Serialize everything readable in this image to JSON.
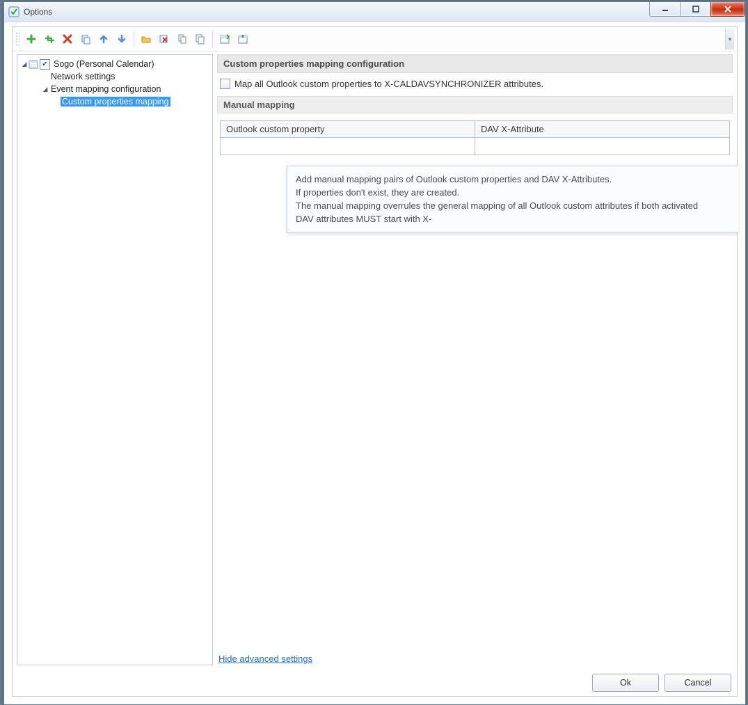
{
  "window": {
    "title": "Options"
  },
  "tree": {
    "root_label": "Sogo (Personal Calendar)",
    "root_checked": true,
    "network_settings": "Network settings",
    "event_mapping": "Event mapping configuration",
    "custom_mapping": "Custom properties mapping"
  },
  "content": {
    "section_title": "Custom properties mapping configuration",
    "map_all_label": "Map all Outlook custom properties to X-CALDAVSYNCHRONIZER attributes.",
    "map_all_checked": false,
    "manual_mapping_title": "Manual mapping",
    "table": {
      "col_outlook": "Outlook custom property",
      "col_dav": "DAV X-Attribute"
    },
    "tooltip": {
      "l1": "Add manual mapping pairs of Outlook custom properties and DAV X-Attributes.",
      "l2": "If properties don't exist, they are created.",
      "l3": "The manual mapping overrules the general mapping of all Outlook custom attributes if both activated",
      "l4": "DAV attributes MUST start with X-"
    },
    "hide_link": "Hide advanced settings"
  },
  "footer": {
    "ok": "Ok",
    "cancel": "Cancel"
  },
  "toolbar_icons": [
    "add-icon",
    "add-multiple-icon",
    "delete-icon",
    "copy-icon",
    "move-up-icon",
    "move-down-icon",
    "open-folder-icon",
    "clear-cache-icon",
    "copy-all-icon",
    "paste-all-icon",
    "calendar-props-icon",
    "calendar-add-icon"
  ]
}
